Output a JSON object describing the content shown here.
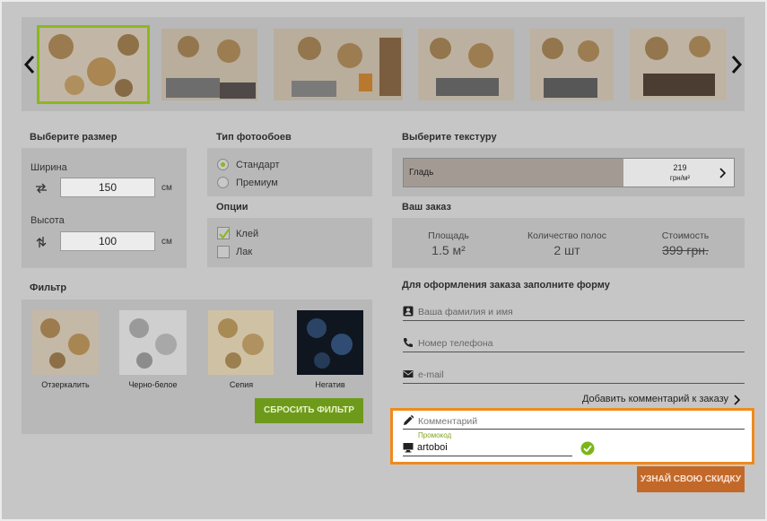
{
  "gallery": {
    "prev_icon": "chevron-left-icon",
    "next_icon": "chevron-right-icon"
  },
  "size": {
    "title": "Выберите размер",
    "width_label": "Ширина",
    "width_value": "150",
    "height_label": "Высота",
    "height_value": "100",
    "unit": "см"
  },
  "type": {
    "title": "Тип фотообоев",
    "options": [
      "Стандарт",
      "Премиум"
    ],
    "selected": "Стандарт"
  },
  "options": {
    "title": "Опции",
    "items": [
      {
        "label": "Клей",
        "checked": true
      },
      {
        "label": "Лак",
        "checked": false
      }
    ]
  },
  "texture": {
    "title": "Выберите текстуру",
    "name": "Гладь",
    "price": "219",
    "price_unit": "грн/м²"
  },
  "order": {
    "title": "Ваш заказ",
    "area_label": "Площадь",
    "area_value": "1.5 м²",
    "strips_label": "Количество полос",
    "strips_value": "2 шт",
    "cost_label": "Стоимость",
    "cost_value": "399 грн."
  },
  "form": {
    "title": "Для оформления заказа заполните форму",
    "name_placeholder": "Ваша фамилия и имя",
    "phone_placeholder": "Номер телефона",
    "email_placeholder": "e-mail",
    "add_comment": "Добавить комментарий к заказу",
    "comment_placeholder": "Комментарий",
    "promo_label": "Промокод",
    "promo_value": "artoboi",
    "discount_button": "УЗНАЙ СВОЮ СКИДКУ"
  },
  "filter": {
    "title": "Фильтр",
    "items": [
      "Отзеркалить",
      "Черно-белое",
      "Сепия",
      "Негатив"
    ],
    "reset_button": "СБРОСИТЬ ФИЛЬТР"
  },
  "colors": {
    "accent_green": "#8ab81f",
    "button_green": "#6e9a1c",
    "button_orange": "#c2692a",
    "highlight": "#f08a1c"
  }
}
